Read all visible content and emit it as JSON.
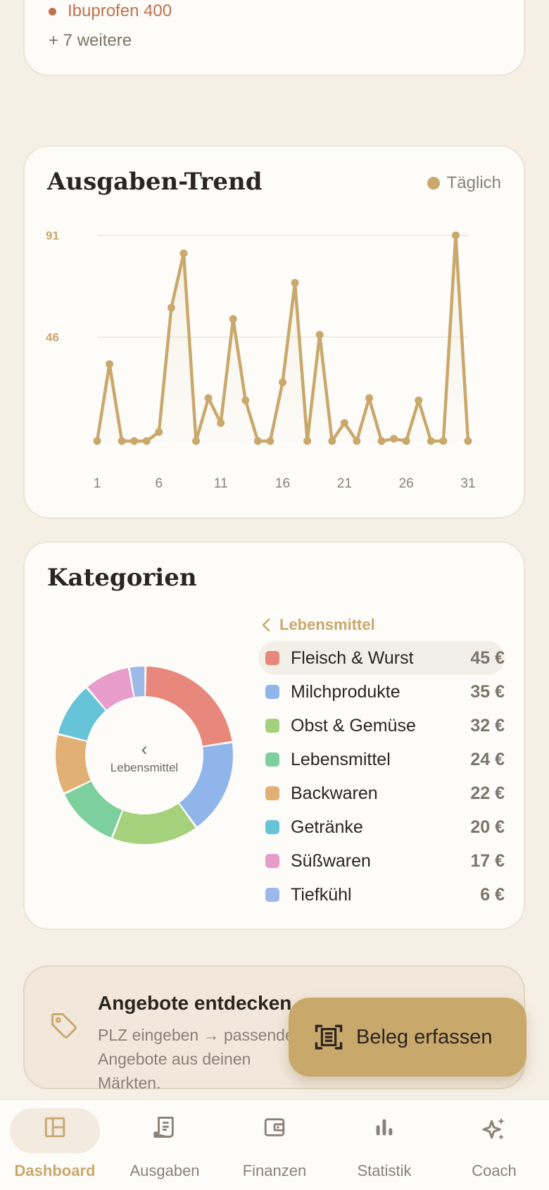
{
  "top_card": {
    "item": "Ibuprofen 400",
    "more": "+ 7 weitere"
  },
  "trend": {
    "title": "Ausgaben-Trend",
    "legend": "Täglich"
  },
  "chart_data": {
    "type": "line",
    "title": "Ausgaben-Trend",
    "series": [
      {
        "name": "Täglich",
        "x": [
          1,
          2,
          3,
          4,
          5,
          6,
          7,
          8,
          9,
          10,
          11,
          12,
          13,
          14,
          15,
          16,
          17,
          18,
          19,
          20,
          21,
          22,
          23,
          24,
          25,
          26,
          27,
          28,
          29,
          30,
          31
        ],
        "values": [
          0,
          34,
          0,
          0,
          0,
          4,
          59,
          83,
          0,
          19,
          8,
          54,
          18,
          0,
          0,
          26,
          70,
          0,
          47,
          0,
          8,
          0,
          19,
          0,
          1,
          0,
          18,
          0,
          0,
          91,
          0
        ]
      }
    ],
    "x_ticks": [
      "1",
      "6",
      "11",
      "16",
      "21",
      "26",
      "31"
    ],
    "y_ticks": [
      "91",
      "46"
    ],
    "xlim": [
      1,
      31
    ],
    "ylim": [
      0,
      91
    ],
    "grid": true,
    "color": "#c9a86c"
  },
  "categories": {
    "title": "Kategorien",
    "breadcrumb": "Lebensmittel",
    "center_label": "Lebensmittel",
    "items": [
      {
        "name": "Fleisch & Wurst",
        "value": "45 €",
        "amount": 45,
        "color": "#e8877b"
      },
      {
        "name": "Milchprodukte",
        "value": "35 €",
        "amount": 35,
        "color": "#8fb5ea"
      },
      {
        "name": "Obst & Gemüse",
        "value": "32 €",
        "amount": 32,
        "color": "#a6d17c"
      },
      {
        "name": "Lebensmittel",
        "value": "24 €",
        "amount": 24,
        "color": "#7ecf9e"
      },
      {
        "name": "Backwaren",
        "value": "22 €",
        "amount": 22,
        "color": "#e1b074"
      },
      {
        "name": "Getränke",
        "value": "20 €",
        "amount": 20,
        "color": "#67c4d8"
      },
      {
        "name": "Süßwaren",
        "value": "17 €",
        "amount": 17,
        "color": "#e89ccb"
      },
      {
        "name": "Tiefkühl",
        "value": "6 €",
        "amount": 6,
        "color": "#9db9e8"
      }
    ]
  },
  "offers": {
    "title": "Angebote entdecken",
    "text": "PLZ eingeben → passende Angebote aus deinen Märkten."
  },
  "fab": {
    "label": "Beleg erfassen"
  },
  "nav": [
    {
      "label": "Dashboard",
      "icon": "dashboard-icon",
      "active": true
    },
    {
      "label": "Ausgaben",
      "icon": "receipt-icon",
      "active": false
    },
    {
      "label": "Finanzen",
      "icon": "wallet-icon",
      "active": false
    },
    {
      "label": "Statistik",
      "icon": "bar-chart-icon",
      "active": false
    },
    {
      "label": "Coach",
      "icon": "sparkle-icon",
      "active": false
    }
  ]
}
